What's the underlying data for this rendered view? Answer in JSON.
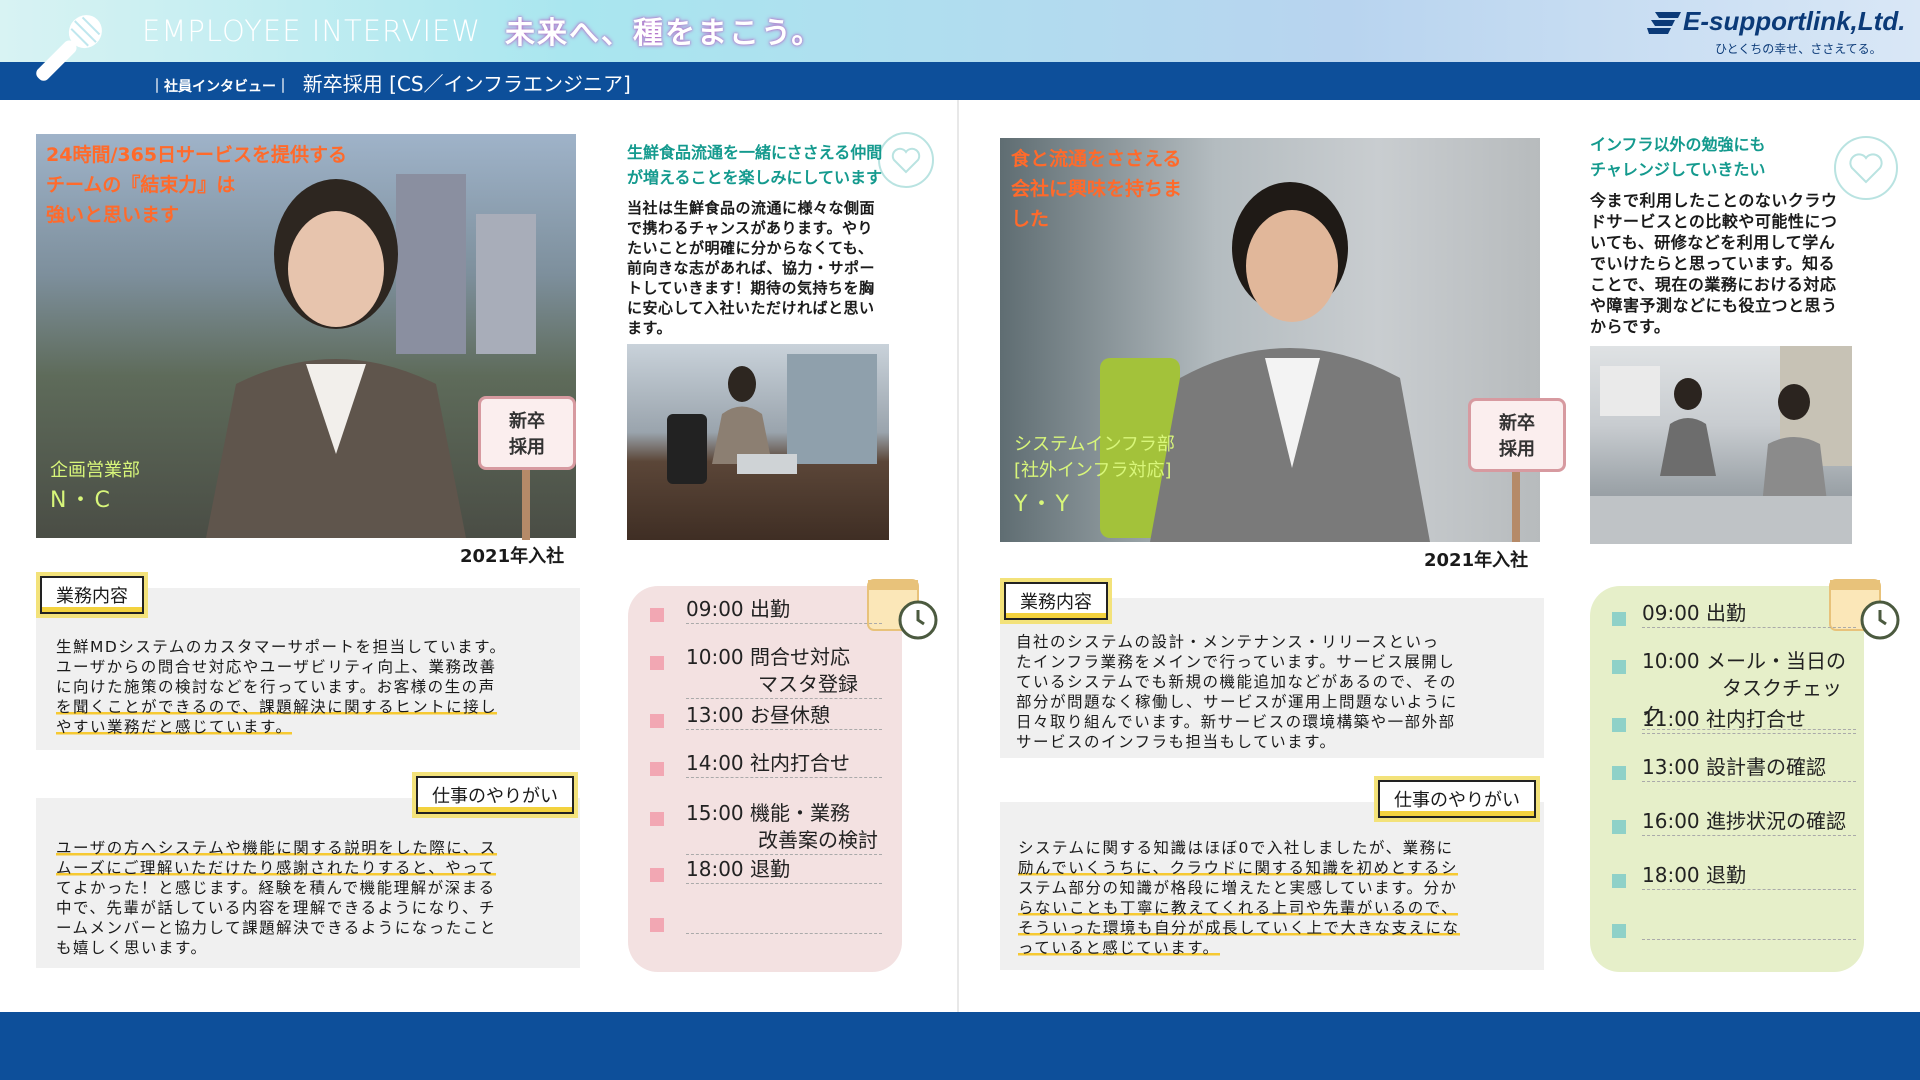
{
  "header": {
    "eng_title": "EMPLOYEE INTERVIEW",
    "catchphrase": "未来へ、種をまこう。",
    "company": "E-supportlink,Ltd.",
    "tagline": "ひとくちの幸せ、ささえてる。",
    "breadcrumb_small": "社員インタビュー",
    "breadcrumb_main": "新卒採用 [CS／インフラエンジニア]"
  },
  "left": {
    "photo_quote": [
      "24時間/365日サービスを提供する",
      "チームの『結束力』は",
      "強いと思います"
    ],
    "department": "企画営業部",
    "initials": "N・C",
    "sign": [
      "新卒",
      "採用"
    ],
    "join_year": "2021年入社",
    "side_heading": [
      "生鮮食品流通を一緒にささえる仲間",
      "が増えることを楽しみにしています"
    ],
    "side_body": [
      "当社は生鮮食品の流通に様々な側面",
      "で携わるチャンスがあります。やり",
      "たいことが明確に分からなくても、",
      "前向きな志があれば、協力・サポー",
      "トしていきます！期待の気持ちを胸",
      "に安心して入社いただければと思い",
      "ます。"
    ],
    "job_tag": "業務内容",
    "job_lines": [
      "生鮮MDシステムのカスタマーサポートを担当しています。",
      "ユーザからの問合せ対応やユーザビリティ向上、業務改善",
      "に向けた施策の検討などを行っています。お客様の生の声",
      "を聞くことができるので、課題解決に関するヒントに接し",
      "やすい業務だと感じています。"
    ],
    "reward_tag": "仕事のやりがい",
    "reward_lines": [
      "ユーザの方へシステムや機能に関する説明をした際に、ス",
      "ムーズにご理解いただけたり感謝されたりすると、やって",
      "てよかった！と感じます。経験を積んで機能理解が深まる",
      "中で、先輩が話している内容を理解できるようになり、チ",
      "ームメンバーと協力して課題解決できるようになったこと",
      "も嬉しく思います。"
    ],
    "schedule": [
      {
        "time": "09:00",
        "text": "出勤",
        "text2": ""
      },
      {
        "time": "10:00",
        "text": "問合せ対応",
        "text2": "マスタ登録"
      },
      {
        "time": "13:00",
        "text": "お昼休憩",
        "text2": ""
      },
      {
        "time": "14:00",
        "text": "社内打合せ",
        "text2": ""
      },
      {
        "time": "15:00",
        "text": "機能・業務",
        "text2": "改善案の検討"
      },
      {
        "time": "18:00",
        "text": "退勤",
        "text2": ""
      },
      {
        "time": "",
        "text": "",
        "text2": ""
      }
    ]
  },
  "right": {
    "photo_quote": [
      "食と流通をささえる",
      "会社に興味を持ちま",
      "した"
    ],
    "department": [
      "システムインフラ部",
      "[社外インフラ対応]"
    ],
    "initials": "Y・Y",
    "sign": [
      "新卒",
      "採用"
    ],
    "join_year": "2021年入社",
    "side_heading": [
      "インフラ以外の勉強にも",
      "チャレンジしていきたい"
    ],
    "side_body": [
      "今まで利用したことのないクラウ",
      "ドサービスとの比較や可能性につ",
      "いても、研修などを利用して学ん",
      "でいけたらと思っています。知る",
      "ことで、現在の業務における対応",
      "や障害予測などにも役立つと思う",
      "からです。"
    ],
    "job_tag": "業務内容",
    "job_lines": [
      "自社のシステムの設計・メンテナンス・リリースといっ",
      "たインフラ業務をメインで行っています。サービス展開し",
      "ているシステムでも新規の機能追加などがあるので、その",
      "部分が問題なく稼働し、サービスが運用上問題ないように",
      "日々取り組んでいます。新サービスの環境構築や一部外部",
      "サービスのインフラも担当もしています。"
    ],
    "reward_tag": "仕事のやりがい",
    "reward_lines": [
      "システムに関する知識はほぼ0で入社しましたが、業務に",
      "励んでいくうちに、クラウドに関する知識を初めとするシ",
      "ステム部分の知識が格段に増えたと実感しています。分か",
      "らないことも丁寧に教えてくれる上司や先輩がいるので、",
      "そういった環境も自分が成長していく上で大きな支えにな",
      "っていると感じています。"
    ],
    "schedule": [
      {
        "time": "09:00",
        "text": "出勤",
        "text2": ""
      },
      {
        "time": "10:00",
        "text": "メール・当日の",
        "text2": "タスクチェック"
      },
      {
        "time": "11:00",
        "text": "社内打合せ",
        "text2": ""
      },
      {
        "time": "13:00",
        "text": "設計書の確認",
        "text2": ""
      },
      {
        "time": "16:00",
        "text": "進捗状況の確認",
        "text2": ""
      },
      {
        "time": "18:00",
        "text": "退勤",
        "text2": ""
      },
      {
        "time": "",
        "text": "",
        "text2": ""
      }
    ]
  },
  "colors": {
    "brand_blue": "#0d4f9a",
    "accent_orange": "#ff6a2b",
    "accent_teal": "#149a8e",
    "underline_yellow": "#f6c932"
  }
}
